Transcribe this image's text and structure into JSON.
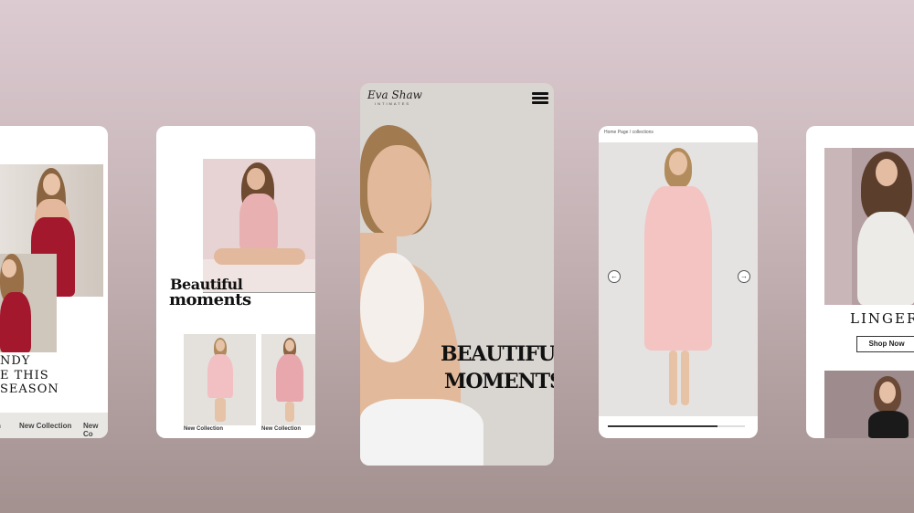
{
  "card1": {
    "headline_line1": "NDY",
    "headline_line2": "E THIS SEASON",
    "tabs": [
      "n",
      "New Collection",
      "New Co"
    ]
  },
  "card2": {
    "headline_line1": "Beautiful",
    "headline_line2": "moments",
    "products": [
      {
        "label": "New Collection"
      },
      {
        "label": "New Collection"
      }
    ]
  },
  "card3": {
    "logo_text": "Eva Shaw",
    "logo_sub": "INTIMATES",
    "menu_icon": "hamburger-icon",
    "headline_line1": "BEAUTIFUL",
    "headline_line2": "MOMENTS"
  },
  "card4": {
    "breadcrumb": "Home Page / collections",
    "prev_icon": "arrow-left-icon",
    "next_icon": "arrow-right-icon",
    "progress": 0.8
  },
  "card5": {
    "headline": "LINGERI",
    "shop_button": "Shop Now"
  },
  "colors": {
    "accent_red": "#a3182c",
    "blush_pink": "#f2bfc3",
    "card3_bg": "#d9d5d1"
  }
}
